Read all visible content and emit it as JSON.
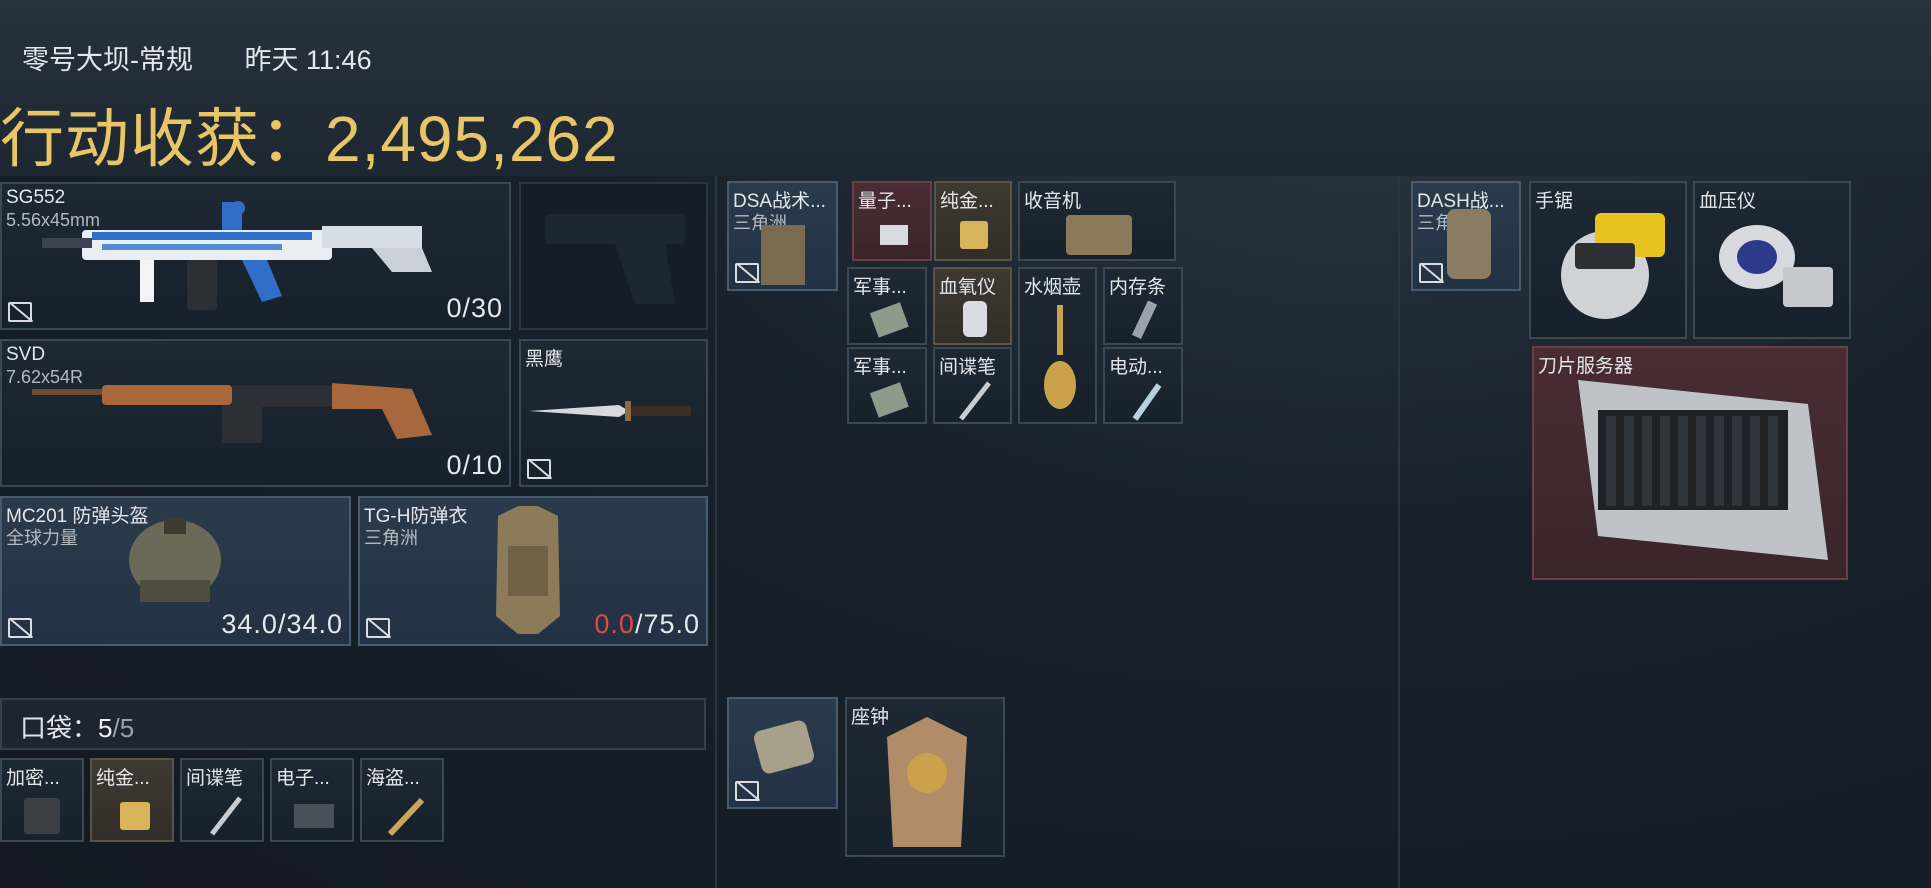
{
  "header": {
    "map": "零号大坝-常规",
    "time": "昨天 11:46",
    "haul_label": "行动收获：",
    "haul_value": "2,495,262"
  },
  "loadout": {
    "primary": {
      "name": "SG552",
      "caliber": "5.56x45mm",
      "ammo": "0/30"
    },
    "pistol": {
      "name": ""
    },
    "secondary": {
      "name": "SVD",
      "caliber": "7.62x54R",
      "ammo": "0/10"
    },
    "melee": {
      "name": "黑鹰"
    },
    "helmet": {
      "name": "MC201 防弹头盔",
      "brand": "全球力量",
      "durability": "34.0/34.0"
    },
    "armor": {
      "name": "TG-H防弹衣",
      "brand": "三角洲",
      "durability_current": "0.0",
      "durability_max": "/75.0"
    }
  },
  "pocket": {
    "label": "口袋：",
    "count": "5",
    "max": "/5",
    "items": [
      {
        "name": "加密..."
      },
      {
        "name": "纯金..."
      },
      {
        "name": "间谍笔"
      },
      {
        "name": "电子..."
      },
      {
        "name": "海盗..."
      }
    ]
  },
  "chest_rig": {
    "name": "DSA战术...",
    "brand": "三角洲",
    "items": [
      {
        "name": "量子...",
        "color": "red"
      },
      {
        "name": "纯金...",
        "color": "gold"
      },
      {
        "name": "收音机",
        "color": "dark"
      },
      {
        "name": "军事...",
        "color": "dark"
      },
      {
        "name": "血氧仪",
        "color": "gold"
      },
      {
        "name": "水烟壶",
        "color": "dark"
      },
      {
        "name": "内存条",
        "color": "dark"
      },
      {
        "name": "军事...",
        "color": "dark"
      },
      {
        "name": "间谍笔",
        "color": "dark"
      },
      {
        "name": "电动...",
        "color": "dark"
      }
    ]
  },
  "case": {
    "name": "",
    "items": [
      {
        "name": "座钟"
      }
    ]
  },
  "backpack": {
    "name": "DASH战...",
    "brand": "三角洲",
    "items": [
      {
        "name": "手锯"
      },
      {
        "name": "血压仪"
      },
      {
        "name": "刀片服务器"
      }
    ]
  },
  "colors": {
    "haul_gold": "#e8c667",
    "durability_low": "#e04a40",
    "rarity_red": "#4a2c33",
    "rarity_gold": "#3e3a32",
    "rarity_blue": "#2a3b4c"
  }
}
